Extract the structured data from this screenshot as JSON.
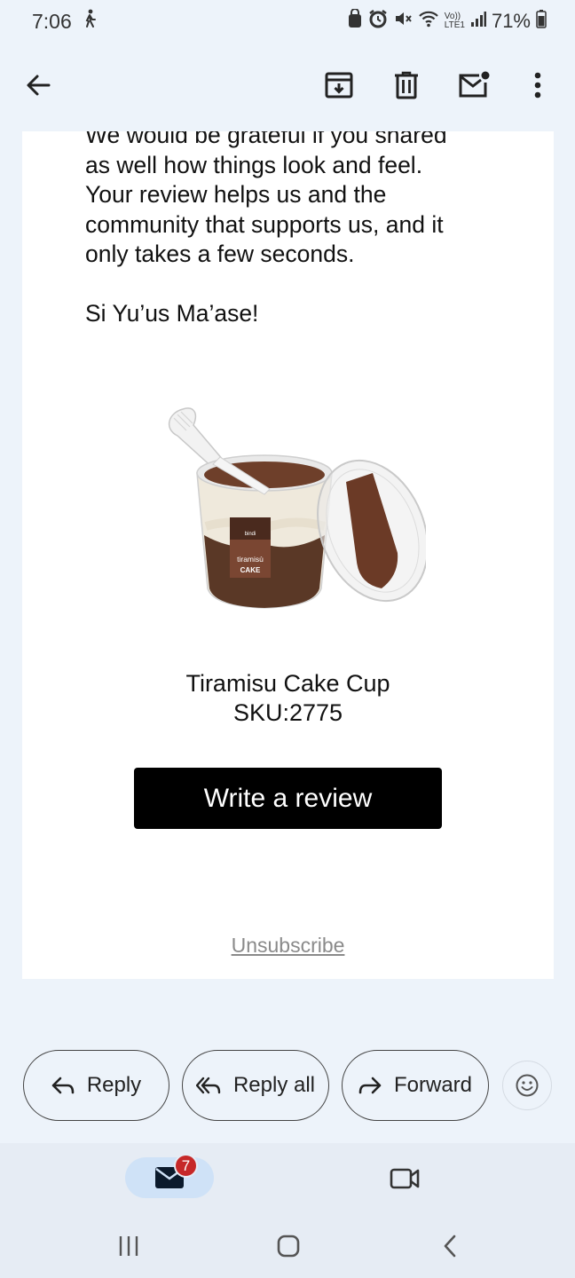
{
  "status": {
    "time": "7:06",
    "network_label_top": "Vo))",
    "network_label_bottom": "LTE1",
    "battery": "71%"
  },
  "toolbar": {
    "back_icon": "arrow-left-icon",
    "archive_icon": "archive-icon",
    "delete_icon": "trash-icon",
    "mark_unread_icon": "mark-unread-icon",
    "more_icon": "more-vert-icon"
  },
  "email": {
    "body_paragraph": "We would be grateful if you shared\nas well how things look and feel.\nYour review helps us and the\ncommunity that supports us, and it\nonly takes a few seconds.",
    "greeting": "Si Yu’us Ma’ase!",
    "product": {
      "image_brand": "bindi",
      "image_label_line1": "tiramisù",
      "image_label_line2": "CAKE",
      "name": "Tiramisu Cake Cup",
      "sku": "SKU:2775"
    },
    "review_button": "Write a review",
    "unsubscribe": "Unsubscribe"
  },
  "actions": {
    "reply": "Reply",
    "reply_all": "Reply all",
    "forward": "Forward",
    "emoji_icon": "emoji-icon"
  },
  "bottom_nav": {
    "mail_badge": "7",
    "mail_icon": "mail-icon",
    "meet_icon": "video-icon"
  },
  "colors": {
    "background": "#edf3fa",
    "button_black": "#000000",
    "badge_red": "#c62828",
    "selected_tab": "#cfe2f7"
  }
}
